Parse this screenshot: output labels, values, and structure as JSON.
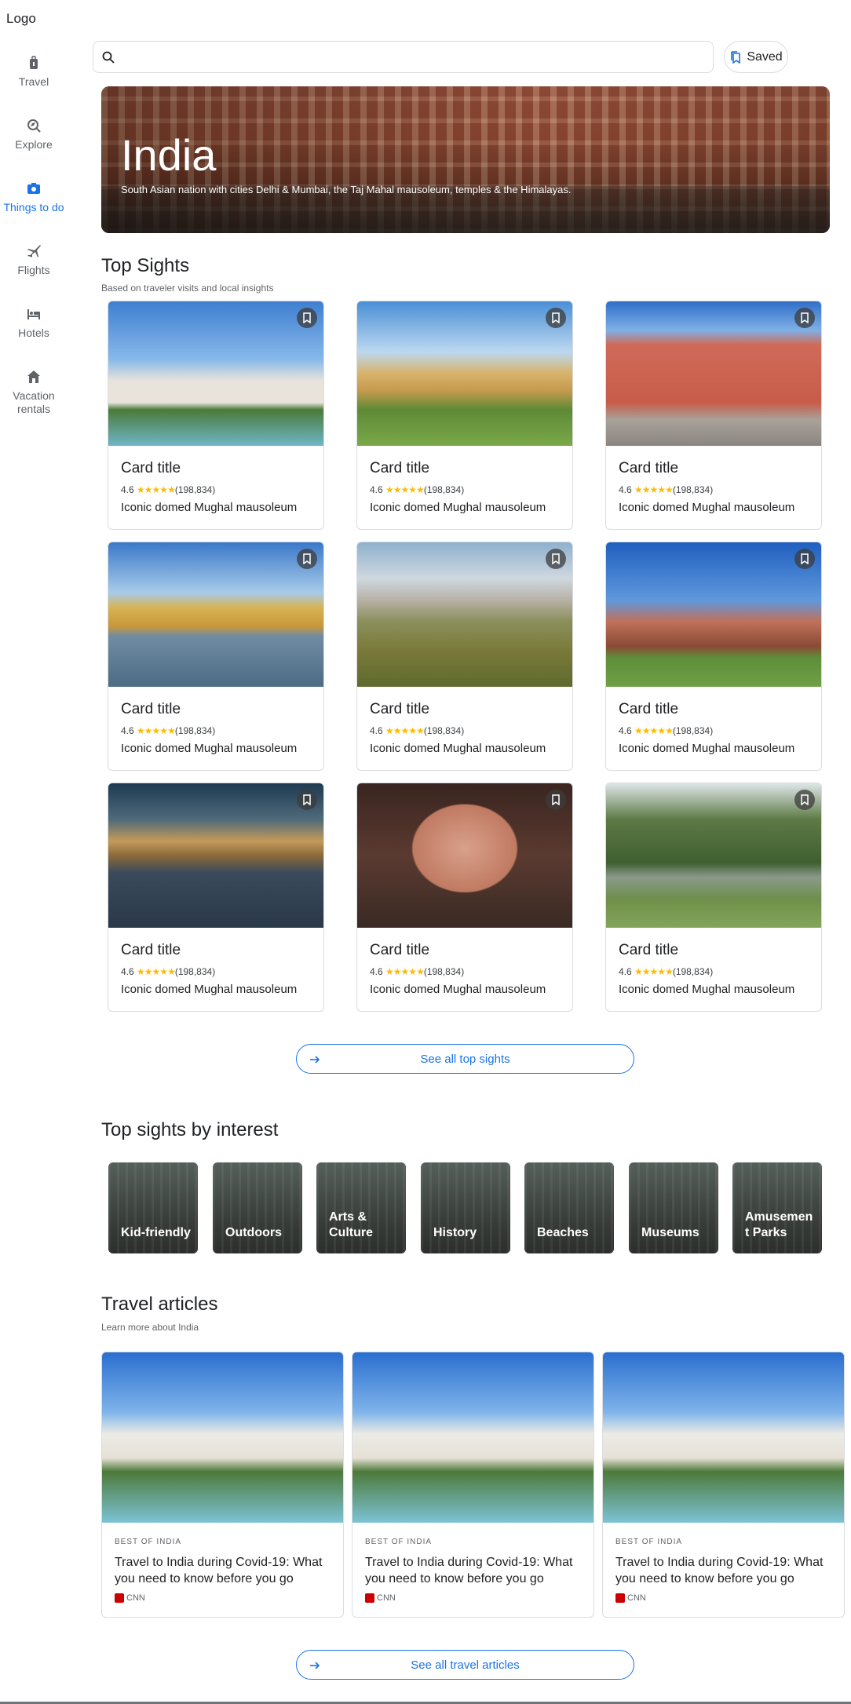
{
  "app": {
    "logo_text": "Logo"
  },
  "sidebar": {
    "items": [
      {
        "label": "Travel",
        "icon": "luggage-icon",
        "active": false
      },
      {
        "label": "Explore",
        "icon": "explore-search-icon",
        "active": false
      },
      {
        "label": "Things to do",
        "icon": "camera-icon",
        "active": true
      },
      {
        "label": "Flights",
        "icon": "airplane-icon",
        "active": false
      },
      {
        "label": "Hotels",
        "icon": "bed-icon",
        "active": false
      },
      {
        "label": "Vacation rentals",
        "icon": "house-icon",
        "active": false
      }
    ]
  },
  "search": {
    "placeholder": "",
    "value": ""
  },
  "saved": {
    "label": "Saved"
  },
  "hero": {
    "title": "India",
    "subtitle": "South Asian nation with cities Delhi & Mumbai, the Taj Mahal mausoleum, temples & the Himalayas."
  },
  "top_sights": {
    "title": "Top Sights",
    "subtitle": "Based on traveler visits and local insights",
    "cards": [
      {
        "title": "Card title",
        "rating": "4.6",
        "stars": "★★★★★",
        "reviews": "(198,834)",
        "desc": "Iconic domed Mughal mausoleum"
      },
      {
        "title": "Card title",
        "rating": "4.6",
        "stars": "★★★★★",
        "reviews": "(198,834)",
        "desc": "Iconic domed Mughal mausoleum"
      },
      {
        "title": "Card title",
        "rating": "4.6",
        "stars": "★★★★★",
        "reviews": "(198,834)",
        "desc": "Iconic domed Mughal mausoleum"
      },
      {
        "title": "Card title",
        "rating": "4.6",
        "stars": "★★★★★",
        "reviews": "(198,834)",
        "desc": "Iconic domed Mughal mausoleum"
      },
      {
        "title": "Card title",
        "rating": "4.6",
        "stars": "★★★★★",
        "reviews": "(198,834)",
        "desc": "Iconic domed Mughal mausoleum"
      },
      {
        "title": "Card title",
        "rating": "4.6",
        "stars": "★★★★★",
        "reviews": "(198,834)",
        "desc": "Iconic domed Mughal mausoleum"
      },
      {
        "title": "Card title",
        "rating": "4.6",
        "stars": "★★★★★",
        "reviews": "(198,834)",
        "desc": "Iconic domed Mughal mausoleum"
      },
      {
        "title": "Card title",
        "rating": "4.6",
        "stars": "★★★★★",
        "reviews": "(198,834)",
        "desc": "Iconic domed Mughal mausoleum"
      },
      {
        "title": "Card title",
        "rating": "4.6",
        "stars": "★★★★★",
        "reviews": "(198,834)",
        "desc": "Iconic domed Mughal mausoleum"
      }
    ],
    "see_all_label": "See all top sights"
  },
  "interests": {
    "title": "Top sights by interest",
    "items": [
      "Kid-friendly",
      "Outdoors",
      "Arts & Culture",
      "History",
      "Beaches",
      "Museums",
      "Amusement Parks"
    ]
  },
  "articles": {
    "title": "Travel articles",
    "subtitle": "Learn more about India",
    "items": [
      {
        "tag": "BEST OF INDIA",
        "headline": "Travel to India during Covid-19: What you need to know before you go",
        "source": "CNN"
      },
      {
        "tag": "BEST OF INDIA",
        "headline": "Travel to India during Covid-19: What you need to know before you go",
        "source": "CNN"
      },
      {
        "tag": "BEST OF INDIA",
        "headline": "Travel to India during Covid-19: What you need to know before you go",
        "source": "CNN"
      }
    ],
    "see_all_label": "See all travel articles"
  },
  "colors": {
    "accent": "#1a73e8",
    "star": "#fbbc04",
    "border": "#dadce0"
  }
}
